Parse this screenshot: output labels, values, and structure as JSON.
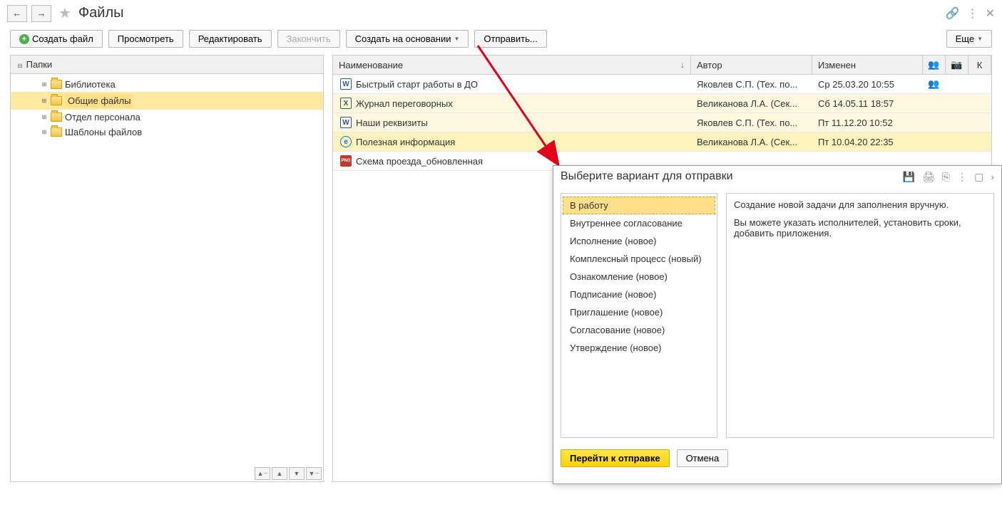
{
  "header": {
    "title": "Файлы"
  },
  "toolbar": {
    "create_file": "Создать файл",
    "view": "Просмотреть",
    "edit": "Редактировать",
    "finish": "Закончить",
    "create_based": "Создать на основании",
    "send": "Отправить...",
    "more": "Еще"
  },
  "tree": {
    "root": "Папки",
    "items": [
      {
        "label": "Библиотека"
      },
      {
        "label": "Общие файлы",
        "selected": true
      },
      {
        "label": "Отдел персонала"
      },
      {
        "label": "Шаблоны файлов"
      }
    ]
  },
  "table": {
    "cols": {
      "name": "Наименование",
      "author": "Автор",
      "modified": "Изменен",
      "k": "К"
    },
    "rows": [
      {
        "icon": "word",
        "name": "Быстрый старт работы в ДО",
        "author": "Яковлев С.П. (Тех. по...",
        "modified": "Ср 25.03.20 10:55",
        "users": true
      },
      {
        "icon": "excel",
        "name": "Журнал переговорных",
        "author": "Великанова Л.А. (Сек...",
        "modified": "Сб 14.05.11 18:57",
        "alt": true
      },
      {
        "icon": "word",
        "name": "Наши реквизиты",
        "author": "Яковлев С.П. (Тех. по...",
        "modified": "Пт 11.12.20 10:52",
        "alt": true
      },
      {
        "icon": "ie",
        "name": "Полезная информация",
        "author": "Великанова Л.А. (Сек...",
        "modified": "Пт 10.04.20 22:35",
        "sel": true
      },
      {
        "icon": "png",
        "name": "Схема проезда_обновленная",
        "author": "",
        "modified": ""
      }
    ]
  },
  "dialog": {
    "title": "Выберите вариант для отправки",
    "options": [
      "В работу",
      "Внутреннее согласование",
      "Исполнение (новое)",
      "Комплексный процесс (новый)",
      "Ознакомление (новое)",
      "Подписание (новое)",
      "Приглашение (новое)",
      "Согласование (новое)",
      "Утверждение (новое)"
    ],
    "desc_1": "Создание новой задачи для заполнения вручную.",
    "desc_2": "Вы можете указать исполнителей, установить сроки, добавить приложения.",
    "go": "Перейти к отправке",
    "cancel": "Отмена"
  }
}
